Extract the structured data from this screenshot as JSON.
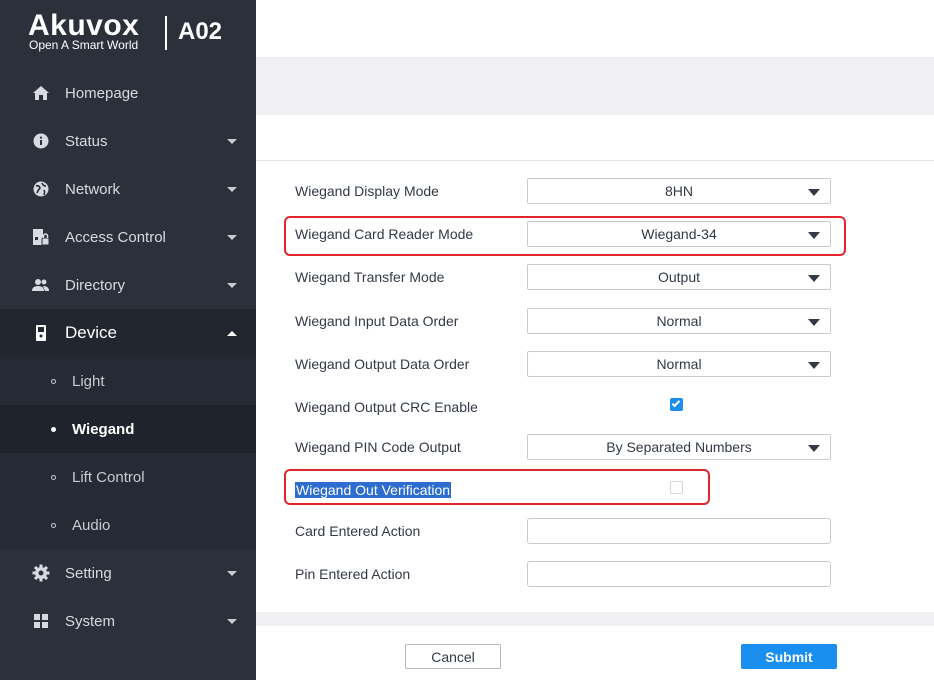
{
  "brand": {
    "name": "Akuvox",
    "tagline": "Open A Smart World",
    "model": "A02"
  },
  "sidebar": {
    "items": [
      {
        "label": "Homepage",
        "icon": "home-icon"
      },
      {
        "label": "Status",
        "icon": "info-icon"
      },
      {
        "label": "Network",
        "icon": "network-icon"
      },
      {
        "label": "Access Control",
        "icon": "access-control-icon"
      },
      {
        "label": "Directory",
        "icon": "directory-icon"
      },
      {
        "label": "Device",
        "icon": "device-icon"
      },
      {
        "label": "Setting",
        "icon": "gear-icon"
      },
      {
        "label": "System",
        "icon": "system-icon"
      }
    ],
    "device_sub": [
      {
        "label": "Light"
      },
      {
        "label": "Wiegand"
      },
      {
        "label": "Lift Control"
      },
      {
        "label": "Audio"
      }
    ]
  },
  "form": {
    "display_mode": {
      "label": "Wiegand Display Mode",
      "value": "8HN"
    },
    "card_reader_mode": {
      "label": "Wiegand Card Reader Mode",
      "value": "Wiegand-34"
    },
    "transfer_mode": {
      "label": "Wiegand Transfer Mode",
      "value": "Output"
    },
    "input_data_order": {
      "label": "Wiegand Input Data Order",
      "value": "Normal"
    },
    "output_data_order": {
      "label": "Wiegand Output Data Order",
      "value": "Normal"
    },
    "output_crc_enable": {
      "label": "Wiegand Output CRC Enable",
      "checked": true
    },
    "pin_code_output": {
      "label": "Wiegand PIN Code Output",
      "value": "By Separated Numbers"
    },
    "out_verification": {
      "label": "Wiegand Out Verification",
      "checked": false
    },
    "card_entered_action": {
      "label": "Card Entered Action",
      "value": ""
    },
    "pin_entered_action": {
      "label": "Pin Entered Action",
      "value": ""
    }
  },
  "buttons": {
    "cancel": "Cancel",
    "submit": "Submit"
  },
  "colors": {
    "accent": "#1b8ff0",
    "highlight": "#e2252b",
    "sidebar": "#2b303b"
  }
}
